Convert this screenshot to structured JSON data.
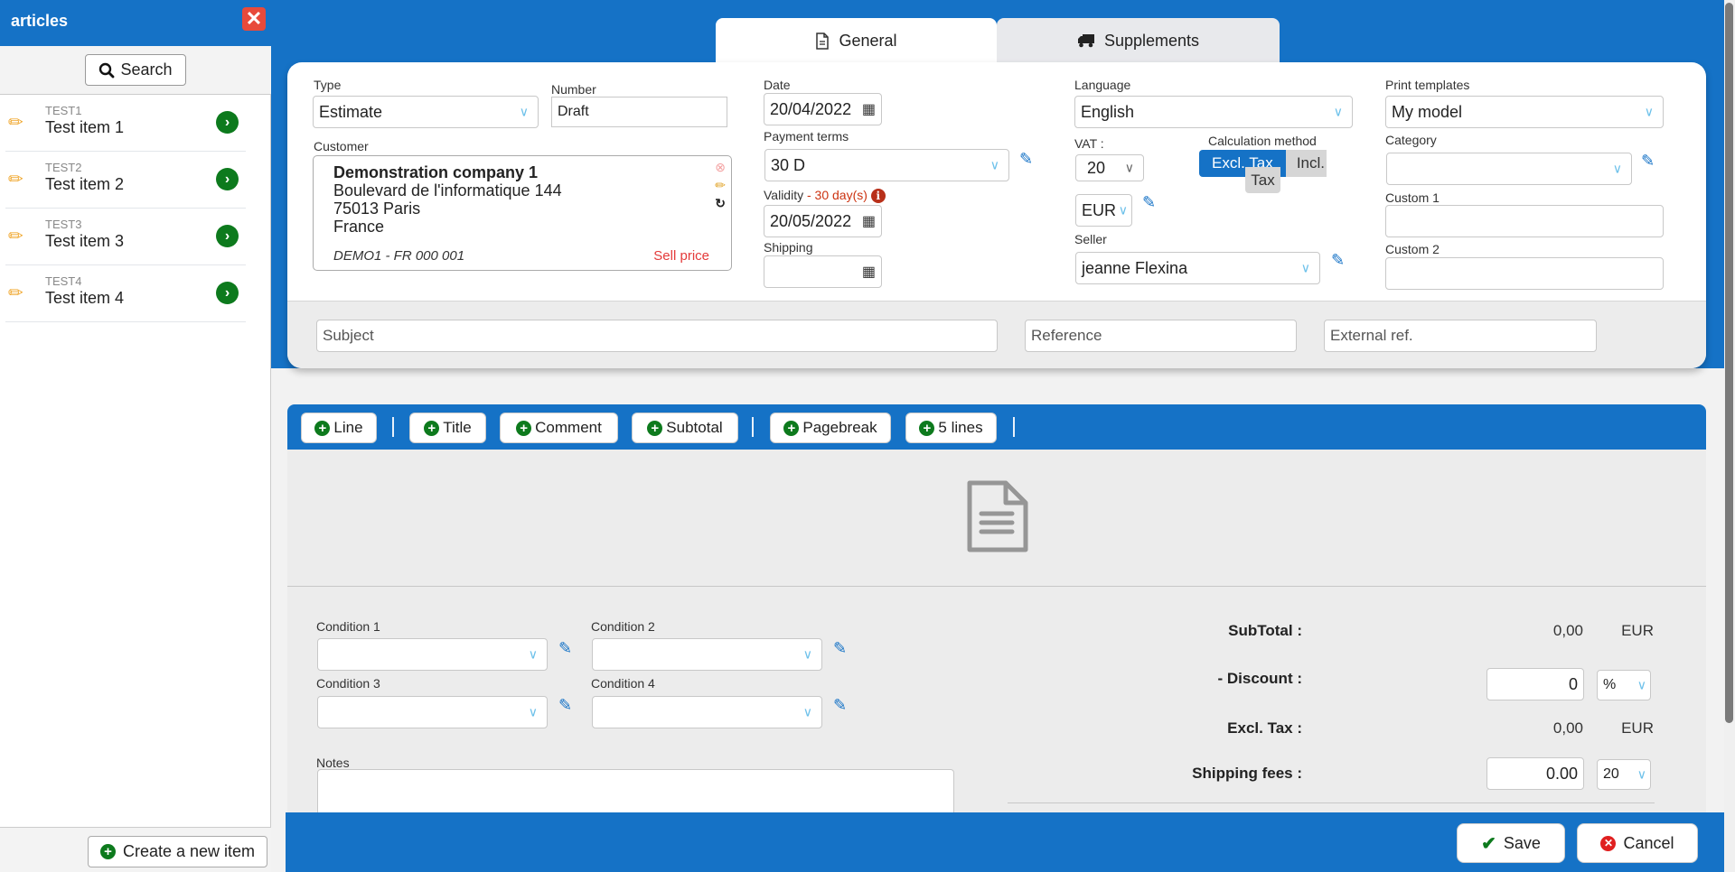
{
  "sidebar": {
    "title": "articles",
    "close_icon": "close-icon",
    "search_label": "Search",
    "items": [
      {
        "code": "TEST1",
        "name": "Test item 1"
      },
      {
        "code": "TEST2",
        "name": "Test item 2"
      },
      {
        "code": "TEST3",
        "name": "Test item 3"
      },
      {
        "code": "TEST4",
        "name": "Test item 4"
      }
    ],
    "create_label": "Create a new item"
  },
  "tabs": [
    {
      "label": "General",
      "icon": "document-icon",
      "active": true
    },
    {
      "label": "Supplements",
      "icon": "truck-icon",
      "active": false
    }
  ],
  "form": {
    "type": {
      "label": "Type",
      "value": "Estimate"
    },
    "number": {
      "label": "Number",
      "value": "Draft"
    },
    "customer": {
      "label": "Customer",
      "name": "Demonstration company 1",
      "address1": "Boulevard de l'informatique 144",
      "address2": "75013 Paris",
      "country": "France",
      "code": "DEMO1 - FR 000 001",
      "price_type": "Sell price"
    },
    "date": {
      "label": "Date",
      "value": "20/04/2022"
    },
    "payment_terms": {
      "label": "Payment terms",
      "value": "30 D"
    },
    "validity": {
      "label": "Validity",
      "note": "- 30 day(s)",
      "value": "20/05/2022"
    },
    "shipping": {
      "label": "Shipping",
      "value": ""
    },
    "language": {
      "label": "Language",
      "value": "English"
    },
    "vat": {
      "label": "VAT :",
      "value": "20"
    },
    "calculation_method": {
      "label": "Calculation method",
      "excl_label": "Excl. Tax",
      "incl_label": "Incl.",
      "incl_label2": "Tax",
      "selected": "Excl. Tax"
    },
    "currency": {
      "value": "EUR"
    },
    "seller": {
      "label": "Seller",
      "value": "jeanne Flexina"
    },
    "print_templates": {
      "label": "Print templates",
      "value": "My model"
    },
    "category": {
      "label": "Category",
      "value": ""
    },
    "custom1": {
      "label": "Custom 1",
      "value": ""
    },
    "custom2": {
      "label": "Custom 2",
      "value": ""
    },
    "subject": {
      "placeholder": "Subject"
    },
    "reference": {
      "placeholder": "Reference"
    },
    "external_ref": {
      "placeholder": "External ref."
    }
  },
  "toolbar": {
    "buttons": [
      "Line",
      "Title",
      "Comment",
      "Subtotal",
      "Pagebreak",
      "5 lines"
    ]
  },
  "conditions": {
    "c1": "Condition 1",
    "c2": "Condition 2",
    "c3": "Condition 3",
    "c4": "Condition 4",
    "notes_label": "Notes"
  },
  "totals": {
    "subtotal_label": "SubTotal :",
    "subtotal_value": "0,00",
    "subtotal_currency": "EUR",
    "discount_label": "- Discount :",
    "discount_value": "0",
    "discount_unit": "%",
    "excl_tax_label": "Excl. Tax :",
    "excl_tax_value": "0,00",
    "excl_tax_currency": "EUR",
    "shipping_label": "Shipping fees :",
    "shipping_value": "0.00",
    "shipping_vat": "20"
  },
  "footer": {
    "save_label": "Save",
    "cancel_label": "Cancel"
  },
  "colors": {
    "primary": "#1572c6",
    "green": "#0d7a1d",
    "danger": "#e84a3b",
    "warning_text": "#cc3311"
  }
}
